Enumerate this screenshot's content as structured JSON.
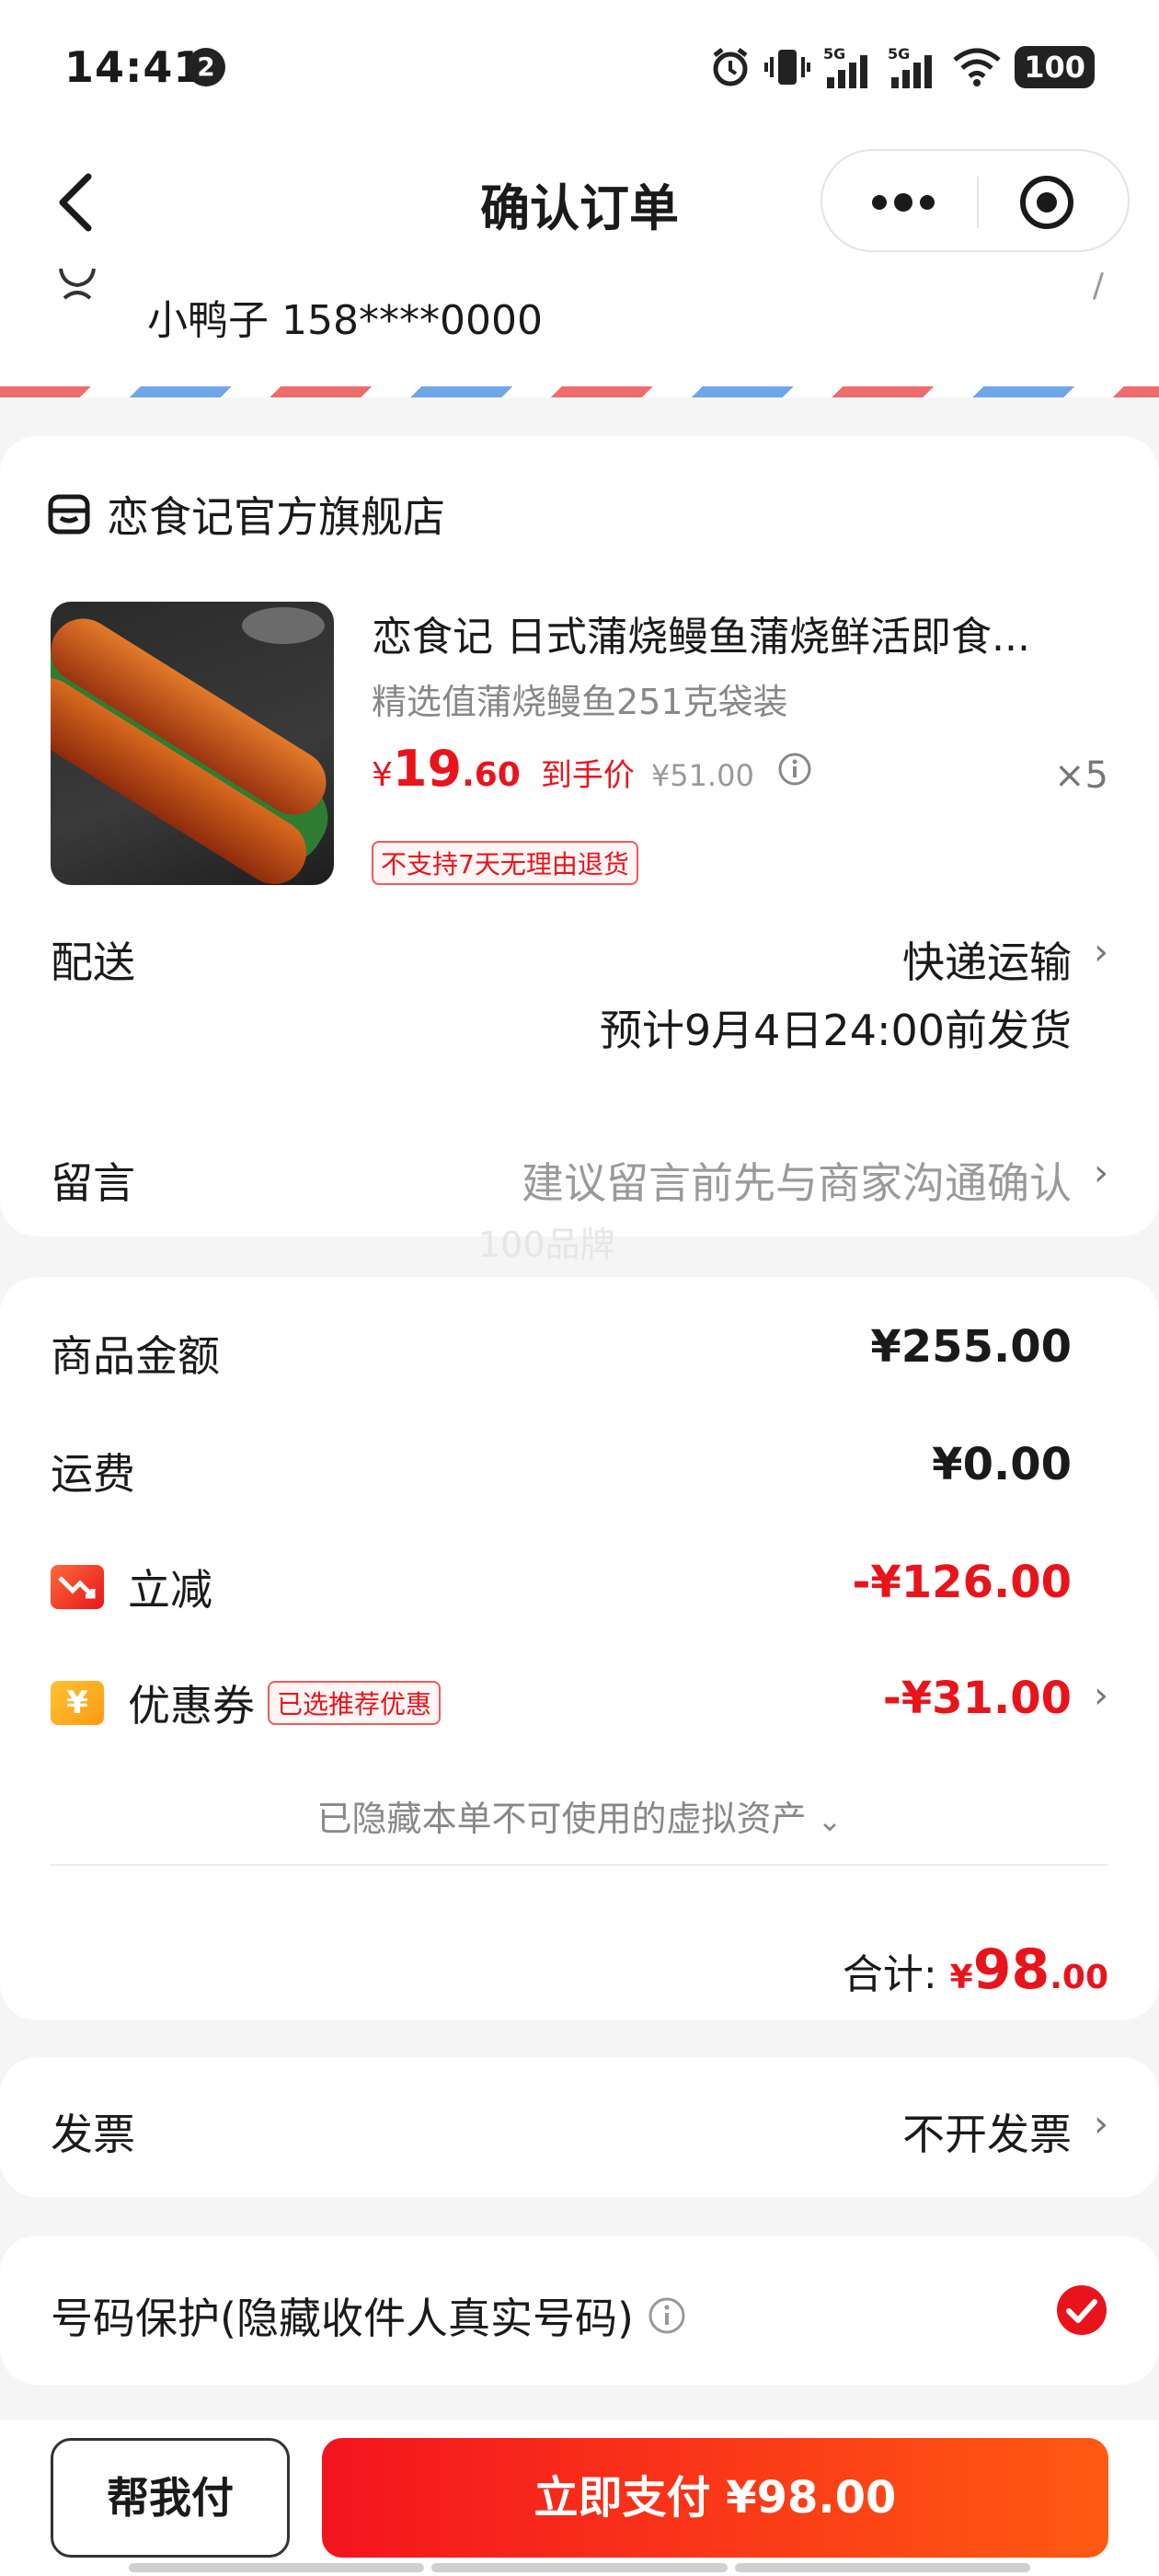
{
  "status_bar": {
    "time": "14:41",
    "notification_count": "2",
    "battery": "100",
    "network_labels": [
      "5G",
      "5G"
    ]
  },
  "nav": {
    "title": "确认订单"
  },
  "address": {
    "name_phone": "小鸭子 158****0000"
  },
  "shop": {
    "name": "恋食记官方旗舰店"
  },
  "product": {
    "title": "恋食记 日式蒲烧鳗鱼蒲烧鲜活即食...",
    "spec": "精选值蒲烧鳗鱼251克袋装",
    "price_symbol": "¥",
    "price_int": "19",
    "price_dec": ".60",
    "final_label": "到手价",
    "original_price": "¥51.00",
    "quantity": "×5",
    "return_tag": "不支持7天无理由退货"
  },
  "delivery": {
    "label": "配送",
    "method": "快递运输",
    "estimate": "预计9月4日24:00前发货"
  },
  "message": {
    "label": "留言",
    "placeholder": "建议留言前先与商家沟通确认"
  },
  "watermark": "100品牌",
  "summary": {
    "goods_label": "商品金额",
    "goods_value": "¥255.00",
    "shipping_label": "运费",
    "shipping_value": "¥0.00",
    "discount_label": "立减",
    "discount_value": "-¥126.00",
    "coupon_label": "优惠券",
    "coupon_tag": "已选推荐优惠",
    "coupon_value": "-¥31.00",
    "hidden_assets": "已隐藏本单不可使用的虚拟资产",
    "total_label": "合计:",
    "total_symbol": "¥",
    "total_int": "98",
    "total_dec": ".00"
  },
  "invoice": {
    "label": "发票",
    "value": "不开发票"
  },
  "privacy": {
    "label": "号码保护(隐藏收件人真实号码)",
    "checked": true
  },
  "bottom": {
    "help_pay": "帮我付",
    "pay_now": "立即支付 ¥98.00"
  },
  "colors": {
    "accent_red": "#e9141b",
    "pay_gradient_end": "#ff5a12"
  }
}
